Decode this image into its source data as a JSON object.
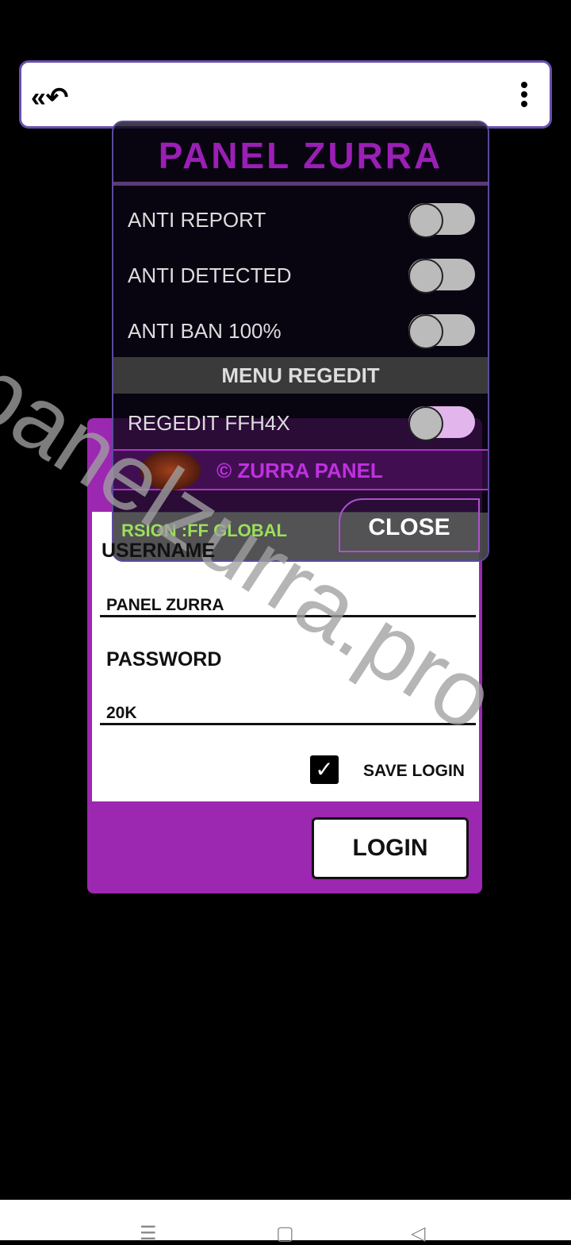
{
  "topbar": {
    "back_icon": "double-reply-arrow",
    "menu_icon": "vertical-dots"
  },
  "panel": {
    "title": "PANEL  ZURRA",
    "toggles": [
      {
        "label": "ANTI REPORT",
        "on": false
      },
      {
        "label": "ANTI DETECTED",
        "on": false
      },
      {
        "label": "ANTI BAN 100%",
        "on": false
      }
    ],
    "menu_header": "MENU REGEDIT",
    "regedit": {
      "label": "REGEDIT FFH4X",
      "on": false
    },
    "credit": "© ZURRA PANEL",
    "version": "RSION :FF GLOBAL",
    "close_label": "CLOSE"
  },
  "login": {
    "username_label": "USERNAME",
    "username_value": "PANEL ZURRA",
    "password_label": "PASSWORD",
    "password_value": "20K",
    "save_login_label": "SAVE LOGIN",
    "save_login_checked": true,
    "login_label": "LOGIN"
  },
  "watermark": "panelzurra.pro",
  "colors": {
    "accent": "#9c27b0",
    "title": "#9a1fb5",
    "version": "#9be05a"
  }
}
